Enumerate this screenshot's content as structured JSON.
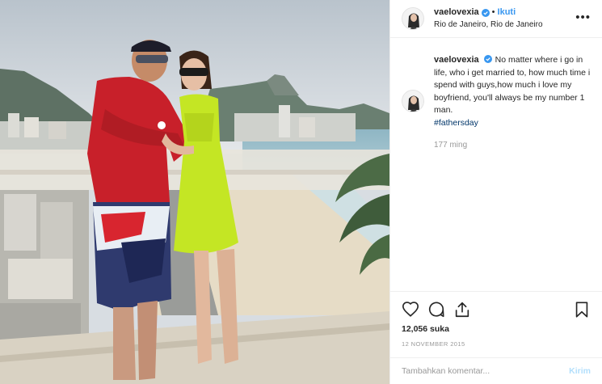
{
  "header": {
    "username": "vaelovexia",
    "dot": "•",
    "follow_label": "Ikuti",
    "location": "Rio de Janeiro, Rio de Janeiro",
    "more": "•••"
  },
  "caption": {
    "username": "vaelovexia",
    "text": "No matter where i go in life, who i get married to, how much time i spend with guys,how much i love my boyfriend, you'll always be my number 1 man.",
    "hashtag": "#fathersday",
    "time": "177 ming"
  },
  "stats": {
    "likes": "12,056 suka",
    "date": "12 NOVEMBER 2015"
  },
  "comment_box": {
    "placeholder": "Tambahkan komentar...",
    "post_label": "Kirim"
  },
  "colors": {
    "accent": "#3897f0",
    "verified": "#3897f0",
    "hashtag": "#003569",
    "muted": "#999999",
    "post_disabled": "#b2dffc"
  }
}
